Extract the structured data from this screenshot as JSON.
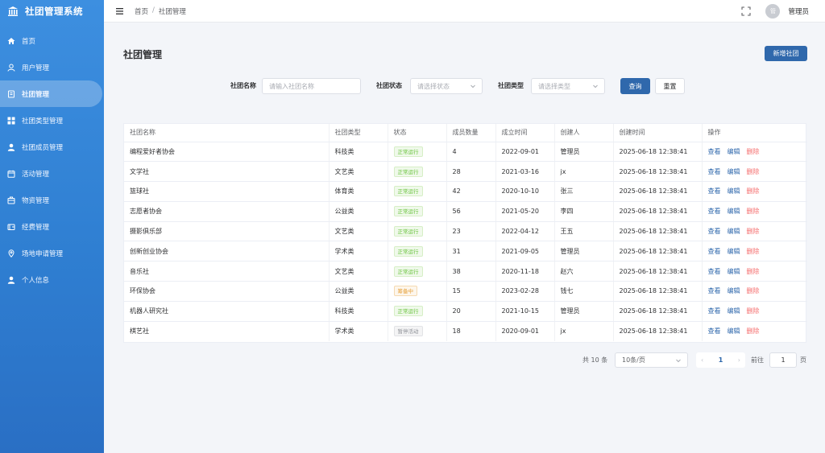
{
  "app": {
    "title": "社团管理系统"
  },
  "sidebar": {
    "items": [
      {
        "label": "首页",
        "icon": "home-icon"
      },
      {
        "label": "用户管理",
        "icon": "user-icon"
      },
      {
        "label": "社团管理",
        "icon": "book-icon",
        "active": true
      },
      {
        "label": "社团类型管理",
        "icon": "grid-icon"
      },
      {
        "label": "社团成员管理",
        "icon": "person-icon"
      },
      {
        "label": "活动管理",
        "icon": "calendar-icon"
      },
      {
        "label": "物资管理",
        "icon": "box-icon"
      },
      {
        "label": "经费管理",
        "icon": "wallet-icon"
      },
      {
        "label": "场地申请管理",
        "icon": "location-icon"
      },
      {
        "label": "个人信息",
        "icon": "person-icon"
      }
    ]
  },
  "header": {
    "breadcrumb": [
      "首页",
      "社团管理"
    ],
    "breadcrumb_sep": "/",
    "avatar_text": "管",
    "user_name": "管理员"
  },
  "main": {
    "page_title": "社团管理",
    "add_button": "新增社团",
    "filters": {
      "name_label": "社团名称",
      "name_placeholder": "请输入社团名称",
      "status_label": "社团状态",
      "status_placeholder": "请选择状态",
      "type_label": "社团类型",
      "type_placeholder": "请选择类型",
      "query_button": "查询",
      "reset_button": "重置"
    },
    "table": {
      "columns": [
        "社团名称",
        "社团类型",
        "状态",
        "成员数量",
        "成立时间",
        "创建人",
        "创建时间",
        "操作"
      ],
      "actions": {
        "view": "查看",
        "edit": "编辑",
        "delete": "删除"
      },
      "rows": [
        {
          "name": "编程爱好者协会",
          "type": "科技类",
          "status": "正常运行",
          "status_kind": "ok",
          "members": "4",
          "founded": "2022-09-01",
          "creator": "管理员",
          "created": "2025-06-18 12:38:41"
        },
        {
          "name": "文学社",
          "type": "文艺类",
          "status": "正常运行",
          "status_kind": "ok",
          "members": "28",
          "founded": "2021-03-16",
          "creator": "jx",
          "created": "2025-06-18 12:38:41"
        },
        {
          "name": "篮球社",
          "type": "体育类",
          "status": "正常运行",
          "status_kind": "ok",
          "members": "42",
          "founded": "2020-10-10",
          "creator": "张三",
          "created": "2025-06-18 12:38:41"
        },
        {
          "name": "志愿者协会",
          "type": "公益类",
          "status": "正常运行",
          "status_kind": "ok",
          "members": "56",
          "founded": "2021-05-20",
          "creator": "李四",
          "created": "2025-06-18 12:38:41"
        },
        {
          "name": "摄影俱乐部",
          "type": "文艺类",
          "status": "正常运行",
          "status_kind": "ok",
          "members": "23",
          "founded": "2022-04-12",
          "creator": "王五",
          "created": "2025-06-18 12:38:41"
        },
        {
          "name": "创新创业协会",
          "type": "学术类",
          "status": "正常运行",
          "status_kind": "ok",
          "members": "31",
          "founded": "2021-09-05",
          "creator": "管理员",
          "created": "2025-06-18 12:38:41"
        },
        {
          "name": "音乐社",
          "type": "文艺类",
          "status": "正常运行",
          "status_kind": "ok",
          "members": "38",
          "founded": "2020-11-18",
          "creator": "赵六",
          "created": "2025-06-18 12:38:41"
        },
        {
          "name": "环保协会",
          "type": "公益类",
          "status": "筹备中",
          "status_kind": "warn",
          "members": "15",
          "founded": "2023-02-28",
          "creator": "钱七",
          "created": "2025-06-18 12:38:41"
        },
        {
          "name": "机器人研究社",
          "type": "科技类",
          "status": "正常运行",
          "status_kind": "ok",
          "members": "20",
          "founded": "2021-10-15",
          "creator": "管理员",
          "created": "2025-06-18 12:38:41"
        },
        {
          "name": "棋艺社",
          "type": "学术类",
          "status": "暂停活动",
          "status_kind": "info",
          "members": "18",
          "founded": "2020-09-01",
          "creator": "jx",
          "created": "2025-06-18 12:38:41"
        }
      ]
    },
    "pagination": {
      "total": "共 10 条",
      "page_size": "10条/页",
      "prev": "‹",
      "current": "1",
      "next": "›",
      "goto_label": "前往",
      "goto_value": "1",
      "page_suffix": "页"
    }
  },
  "colors": {
    "primary": "#2f68ac",
    "sidebar": "#3d8fe0",
    "success": "#67c23a",
    "warning": "#e6a23c",
    "danger": "#f56c6c"
  }
}
